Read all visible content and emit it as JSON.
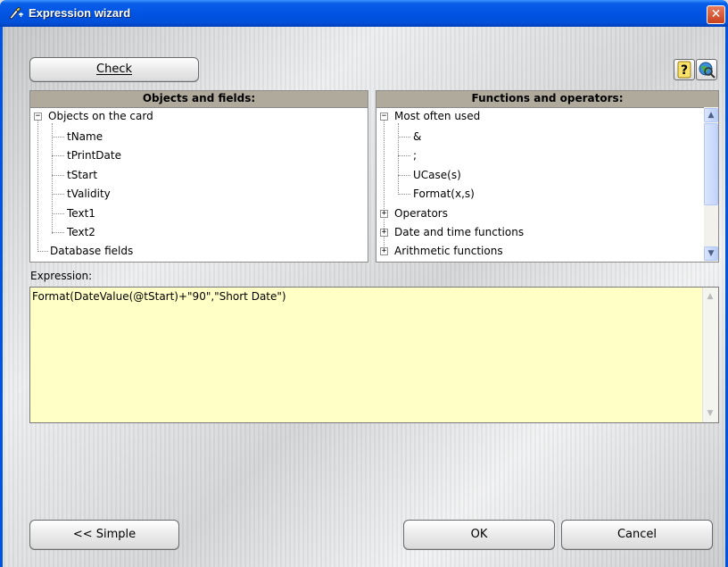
{
  "window": {
    "title": "Expression wizard",
    "close_label": "✕"
  },
  "toolbar": {
    "check_label": "Check",
    "help_icon": "question-mark-icon",
    "web_icon": "globe-search-icon"
  },
  "objects_panel": {
    "header": "Objects and fields:",
    "root": "Objects on the card",
    "children": [
      "tName",
      "tPrintDate",
      "tStart",
      "tValidity",
      "Text1",
      "Text2"
    ],
    "sibling": "Database fields"
  },
  "functions_panel": {
    "header": "Functions and operators:",
    "root": "Most often used",
    "children": [
      "&",
      ";",
      "UCase(s)",
      "Format(x,s)"
    ],
    "collapsed": [
      "Operators",
      "Date and time functions",
      "Arithmetic functions"
    ]
  },
  "expression": {
    "label": "Expression:",
    "value": "Format(DateValue(@tStart)+\"90\",\"Short Date\")"
  },
  "buttons": {
    "simple": "<< Simple",
    "ok": "OK",
    "cancel": "Cancel"
  },
  "colors": {
    "titlebar": "#0054e3",
    "panel_header": "#b0aa9c",
    "expression_bg": "#ffffc6"
  }
}
